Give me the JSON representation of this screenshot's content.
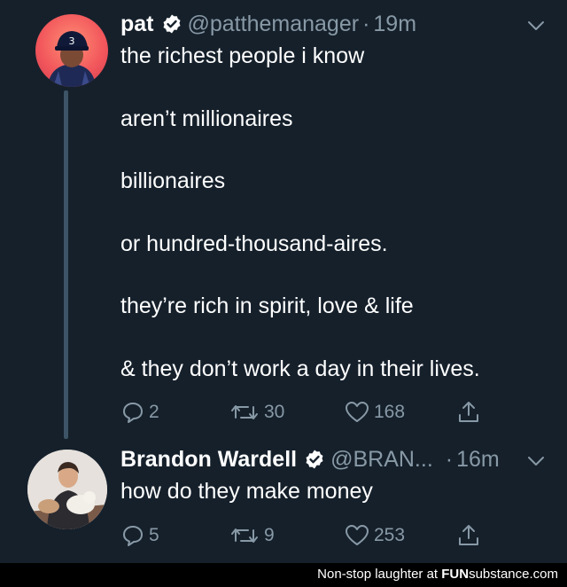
{
  "tweets": [
    {
      "name": "pat",
      "handle": "@patthemanager",
      "separator": "·",
      "time": "19m",
      "avatar_badge": "3",
      "lines": [
        "the richest people i know",
        "aren’t millionaires",
        "billionaires",
        "or hundred-thousand-aires.",
        "they’re rich in spirit, love & life",
        "& they don’t work a day in their lives."
      ],
      "actions": {
        "replies": "2",
        "retweets": "30",
        "likes": "168"
      }
    },
    {
      "name": "Brandon Wardell",
      "handle": "@BRAN...",
      "separator": "·",
      "time": "16m",
      "lines": [
        "how do they make money"
      ],
      "actions": {
        "replies": "5",
        "retweets": "9",
        "likes": "253"
      }
    }
  ],
  "footer": {
    "prefix": "Non-stop laughter at",
    "brand_bold": "FUN",
    "brand_rest": "substance",
    "brand_suffix": ".com"
  },
  "colors": {
    "background": "#15202b",
    "muted": "#8899a6",
    "verified": "#ffffff"
  },
  "icons": [
    "verified-icon",
    "chevron-down-icon",
    "reply-icon",
    "retweet-icon",
    "like-icon",
    "share-icon"
  ]
}
